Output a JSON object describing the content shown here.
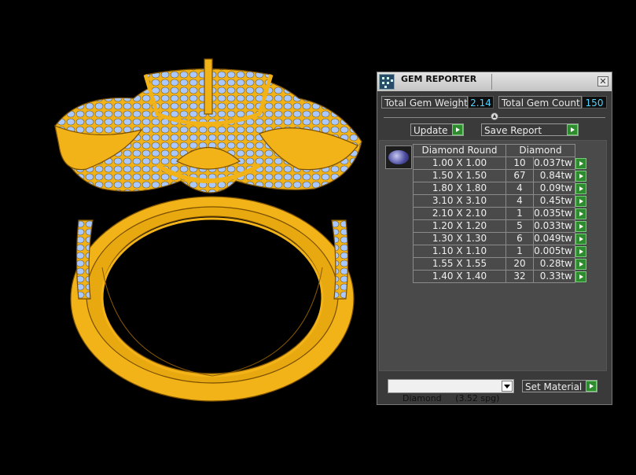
{
  "panel": {
    "title": "GEM REPORTER",
    "total_gem_weight_label": "Total Gem Weight",
    "total_gem_weight_value": "2.14",
    "total_gem_count_label": "Total Gem Count",
    "total_gem_count_value": "150",
    "update_label": "Update",
    "save_report_label": "Save Report",
    "table": {
      "header_size": "Diamond Round",
      "header_type": "Diamond",
      "rows": [
        {
          "size": "1.00 X 1.00",
          "count": "10",
          "weight": "0.037tw"
        },
        {
          "size": "1.50 X 1.50",
          "count": "67",
          "weight": "0.84tw"
        },
        {
          "size": "1.80 X 1.80",
          "count": "4",
          "weight": "0.09tw"
        },
        {
          "size": "3.10 X 3.10",
          "count": "4",
          "weight": "0.45tw"
        },
        {
          "size": "2.10 X 2.10",
          "count": "1",
          "weight": "0.035tw"
        },
        {
          "size": "1.20 X 1.20",
          "count": "5",
          "weight": "0.033tw"
        },
        {
          "size": "1.30 X 1.30",
          "count": "6",
          "weight": "0.049tw"
        },
        {
          "size": "1.10 X 1.10",
          "count": "1",
          "weight": "0.005tw"
        },
        {
          "size": "1.55 X 1.55",
          "count": "20",
          "weight": "0.28tw"
        },
        {
          "size": "1.40 X 1.40",
          "count": "32",
          "weight": "0.33tw"
        }
      ]
    },
    "material_select": "Diamond     (3.52 spg)",
    "set_material_label": "Set Material",
    "close_glyph": "✕"
  },
  "colors": {
    "metal": "#f2b318",
    "metal_edge": "#8a5a00",
    "gem": "#a8c8ff",
    "value_text": "#4fd3ff",
    "play_button": "#2e8b2e"
  },
  "icons": [
    "gem-reporter-app-icon",
    "close-icon",
    "collapse-arrow-icon",
    "play-arrow-icon",
    "diamond-round-icon",
    "dropdown-arrow-icon"
  ]
}
